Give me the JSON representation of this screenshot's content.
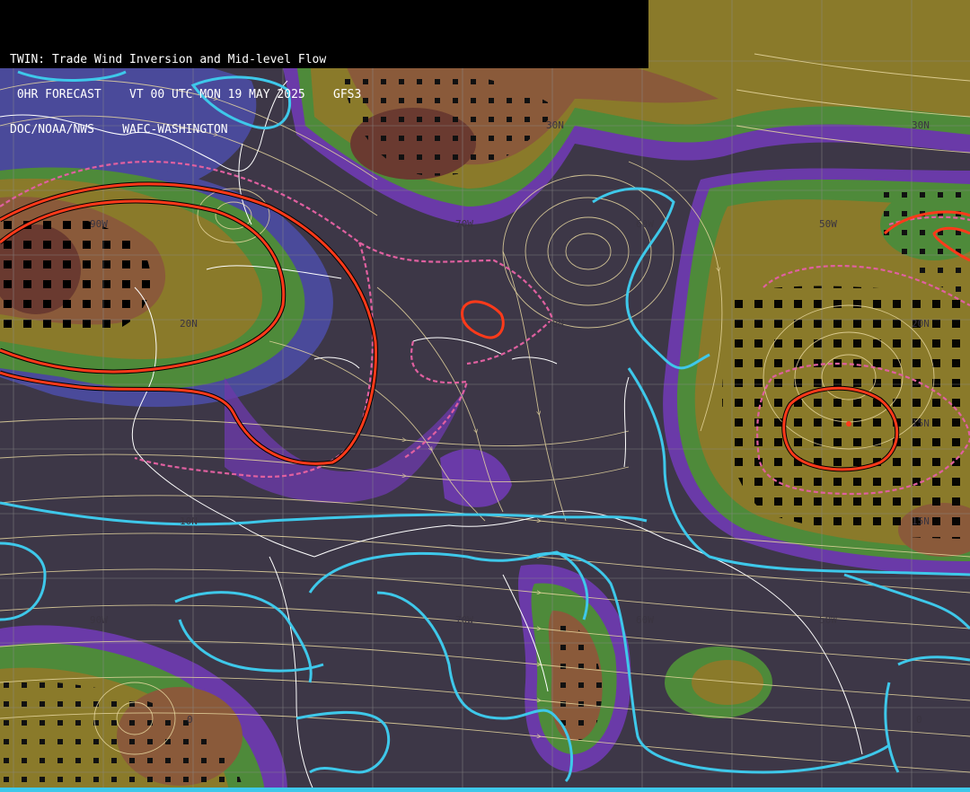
{
  "header": {
    "line1": "TWIN: Trade Wind Inversion and Mid-level Flow",
    "line2": " 0HR FORECAST    VT 00 UTC MON 19 MAY 2025    GFS3",
    "line3": "DOC/NOAA/NWS    WAFC-WASHINGTON"
  },
  "grid_labels": [
    {
      "text": "30N"
    },
    {
      "text": "30N"
    },
    {
      "text": "90W"
    },
    {
      "text": "70W"
    },
    {
      "text": "60W"
    },
    {
      "text": "50W"
    },
    {
      "text": "20N"
    },
    {
      "text": "20N"
    },
    {
      "text": "20N"
    },
    {
      "text": "15N"
    },
    {
      "text": "15N"
    },
    {
      "text": "10N"
    },
    {
      "text": "90W"
    },
    {
      "text": "70W"
    },
    {
      "text": "60W"
    },
    {
      "text": "50W"
    },
    {
      "text": "0"
    },
    {
      "text": "0"
    }
  ],
  "colors": {
    "background": "#3d3747",
    "purple": "#6a3aa8",
    "blue": "#4a4a9a",
    "green": "#4e8a3a",
    "olive": "#8a7a2a",
    "brown": "#8a5a3a",
    "dark_brown": "#6a3a30",
    "streamline": "#e8d8a0",
    "coast": "#ffffff",
    "cyan_contour": "#3ec8ea",
    "red_contour": "#ff2a1a",
    "pink_dashed": "#e060a0"
  }
}
